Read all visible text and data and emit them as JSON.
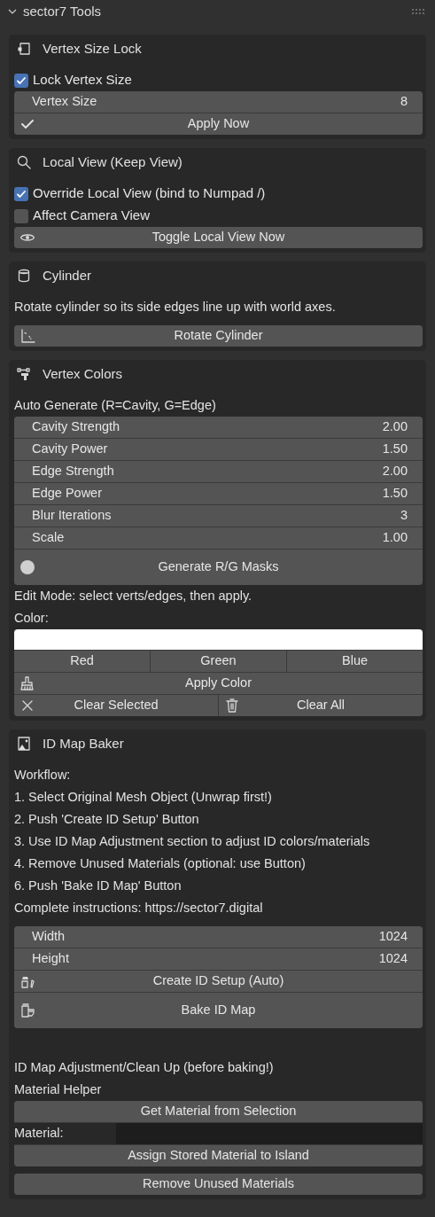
{
  "header": {
    "title": "sector7 Tools",
    "expanded": true
  },
  "panels": [
    {
      "title": "Vertex Size Lock",
      "items": [
        {
          "kind": "checkbox",
          "label": "Lock Vertex Size",
          "checked": true
        },
        {
          "kind": "column",
          "rows": [
            {
              "kind": "number",
              "label": "Vertex Size",
              "value": "8"
            },
            {
              "kind": "button",
              "label": "Apply Now"
            }
          ]
        }
      ]
    },
    {
      "title": "Local View (Keep View)",
      "items": [
        {
          "kind": "checkbox",
          "label": "Override Local View (bind to Numpad /)",
          "checked": true
        },
        {
          "kind": "checkbox",
          "label": "Affect Camera View",
          "checked": false
        },
        {
          "kind": "column",
          "rows": [
            {
              "kind": "button",
              "label": "Toggle Local View Now"
            }
          ]
        }
      ]
    },
    {
      "title": "Cylinder",
      "items": [
        {
          "kind": "text",
          "text": "Rotate cylinder so its side edges line up with world axes."
        },
        {
          "kind": "spacer"
        },
        {
          "kind": "column",
          "rows": [
            {
              "kind": "button",
              "label": "Rotate Cylinder"
            }
          ]
        }
      ]
    },
    {
      "title": "Vertex Colors",
      "items": [
        {
          "kind": "text",
          "text": "Auto Generate (R=Cavity, G=Edge)"
        },
        {
          "kind": "column",
          "rows": [
            {
              "kind": "number",
              "label": "Cavity Strength",
              "value": "2.00"
            },
            {
              "kind": "number",
              "label": "Cavity Power",
              "value": "1.50"
            },
            {
              "kind": "number",
              "label": "Edge Strength",
              "value": "2.00"
            },
            {
              "kind": "number",
              "label": "Edge Power",
              "value": "1.50"
            },
            {
              "kind": "number",
              "label": "Blur Iterations",
              "value": "3"
            },
            {
              "kind": "number",
              "label": "Scale",
              "value": "1.00"
            },
            {
              "kind": "button",
              "label": "Generate R/G Masks",
              "large": true
            }
          ]
        },
        {
          "kind": "text",
          "text": "Edit Mode: select verts/edges, then apply."
        },
        {
          "kind": "text",
          "text": "Color:"
        },
        {
          "kind": "column",
          "rows": [
            {
              "kind": "swatch",
              "color": "#ffffff"
            },
            {
              "kind": "buttons",
              "buttons": [
                {
                  "label": "Red"
                },
                {
                  "label": "Green"
                },
                {
                  "label": "Blue"
                }
              ]
            },
            {
              "kind": "button",
              "label": "Apply Color"
            },
            {
              "kind": "buttons",
              "buttons": [
                {
                  "label": "Clear Selected"
                },
                {
                  "label": "Clear All"
                }
              ]
            }
          ]
        }
      ]
    },
    {
      "title": "ID Map Baker",
      "items": [
        {
          "kind": "text",
          "text": "Workflow:"
        },
        {
          "kind": "text",
          "text": "1. Select Original Mesh Object (Unwrap first!)"
        },
        {
          "kind": "text",
          "text": "2. Push 'Create ID Setup' Button"
        },
        {
          "kind": "text",
          "text": "3. Use ID Map Adjustment section to adjust ID colors/materials"
        },
        {
          "kind": "text",
          "text": "4. Remove Unused Materials (optional: use Button)"
        },
        {
          "kind": "text",
          "text": "6. Push 'Bake ID Map' Button"
        },
        {
          "kind": "text",
          "text": "Complete instructions: https://sector7.digital"
        },
        {
          "kind": "spacer"
        },
        {
          "kind": "column",
          "rows": [
            {
              "kind": "number",
              "label": "Width",
              "value": "1024"
            },
            {
              "kind": "number",
              "label": "Height",
              "value": "1024"
            },
            {
              "kind": "button",
              "label": "Create ID Setup (Auto)"
            },
            {
              "kind": "button",
              "label": "Bake ID Map",
              "large": true
            }
          ]
        },
        {
          "kind": "spacer"
        },
        {
          "kind": "spacer"
        },
        {
          "kind": "spacer"
        },
        {
          "kind": "spacer"
        },
        {
          "kind": "text",
          "text": "ID Map Adjustment/Clean Up (before baking!)"
        },
        {
          "kind": "text",
          "text": "Material Helper"
        },
        {
          "kind": "column",
          "rows": [
            {
              "kind": "button",
              "label": "Get Material from Selection"
            },
            {
              "kind": "prop",
              "label": "Material:"
            },
            {
              "kind": "button",
              "label": "Assign Stored Material to Island"
            }
          ]
        },
        {
          "kind": "spacer"
        },
        {
          "kind": "column",
          "rows": [
            {
              "kind": "button",
              "label": "Remove Unused Materials"
            }
          ]
        }
      ]
    }
  ]
}
